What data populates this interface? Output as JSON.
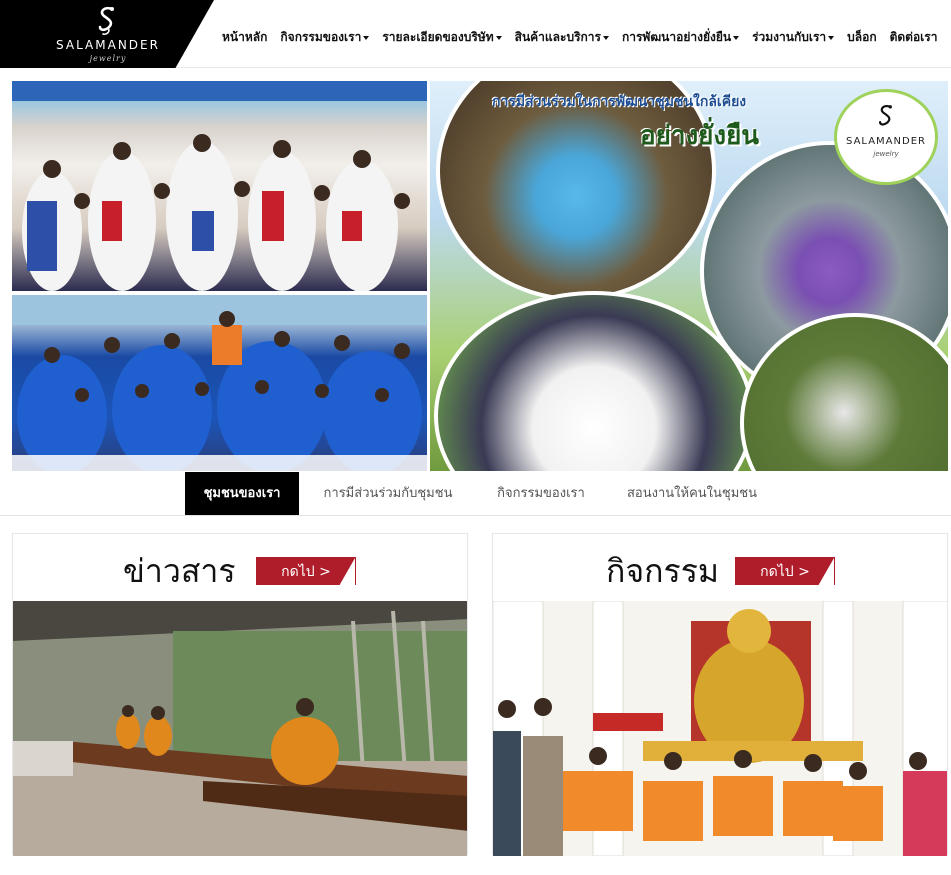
{
  "brand": {
    "name": "SALAMANDER",
    "tagline": "jewelry"
  },
  "nav": {
    "items": [
      {
        "label": "หน้าหลัก",
        "dropdown": false
      },
      {
        "label": "กิจกรรมของเรา",
        "dropdown": true
      },
      {
        "label": "รายละเอียดของบริษัท",
        "dropdown": true
      },
      {
        "label": "สินค้าและบริการ",
        "dropdown": true
      },
      {
        "label": "การพัฒนาอย่างยั่งยืน",
        "dropdown": true
      },
      {
        "label": "ร่วมงานกับเรา",
        "dropdown": true
      },
      {
        "label": "บล็อก",
        "dropdown": false
      },
      {
        "label": "ติดต่อเรา",
        "dropdown": false
      }
    ]
  },
  "hero": {
    "headline_1": "การมีส่วนร่วมในการพัฒนาชุมชนใกล้เคียง",
    "headline_2": "อย่างยั่งยืน",
    "logo_name": "SALAMANDER",
    "logo_tagline": "jewelry"
  },
  "tabs": [
    {
      "label": "ชุมชนของเรา",
      "active": true
    },
    {
      "label": "การมีส่วนร่วมกับชุมชน",
      "active": false
    },
    {
      "label": "กิจกรรมของเรา",
      "active": false
    },
    {
      "label": "สอนงานให้คนในชุมชน",
      "active": false
    }
  ],
  "cards": [
    {
      "title": "ข่าวสาร",
      "button": "กดไป >"
    },
    {
      "title": "กิจกรรม",
      "button": "กดไป >"
    }
  ],
  "colors": {
    "accent_red": "#b01d2a",
    "header_black": "#000000",
    "tab_active": "#000000"
  }
}
